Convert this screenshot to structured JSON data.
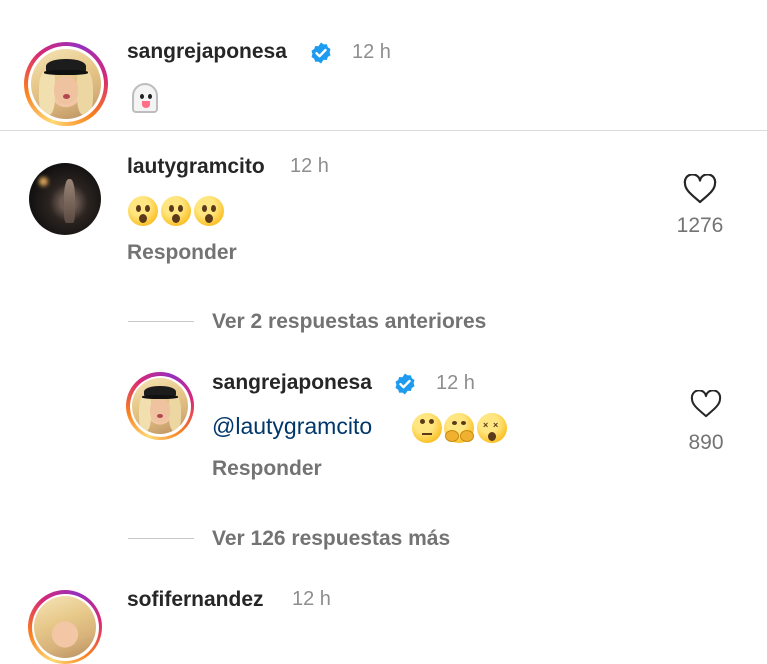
{
  "comments": [
    {
      "username": "sangrejaponesa",
      "verified": true,
      "time": "12 h",
      "emojis": [
        "ghost-tongue-emoji"
      ]
    },
    {
      "username": "lautygramcito",
      "verified": false,
      "time": "12 h",
      "emojis": [
        "hushed-face-emoji",
        "hushed-face-emoji",
        "hushed-face-emoji"
      ],
      "reply_label": "Responder",
      "likes": "1276"
    },
    {
      "username": "sangrejaponesa",
      "verified": true,
      "time": "12 h",
      "mention": "@lautygramcito",
      "emojis": [
        "eye-roll-emoji",
        "hugging-face-emoji",
        "dizzy-face-emoji"
      ],
      "reply_label": "Responder",
      "likes": "890"
    },
    {
      "username": "sofifernandez",
      "time": "12 h"
    }
  ],
  "view_previous_replies": "Ver 2 respuestas anteriores",
  "view_more_replies": "Ver 126 respuestas más",
  "colors": {
    "username": "#262626",
    "meta": "#8e8e8e",
    "mention": "#00376b",
    "verified": "#1d9bf0"
  }
}
